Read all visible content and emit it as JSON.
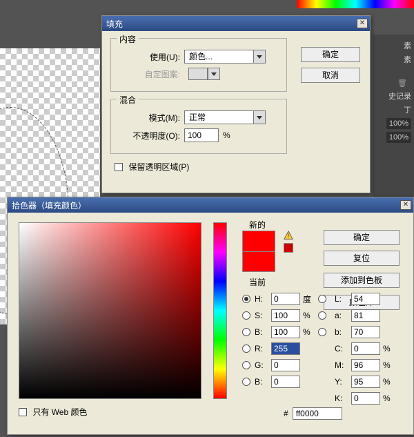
{
  "fill": {
    "title": "填充",
    "group_content": "内容",
    "use_label": "使用(U):",
    "use_value": "颜色...",
    "pattern_label": "自定图案:",
    "group_blend": "混合",
    "mode_label": "模式(M):",
    "mode_value": "正常",
    "opacity_label": "不透明度(O):",
    "opacity_value": "100",
    "opacity_unit": "%",
    "preserve_transparency": "保留透明区域(P)",
    "ok": "确定",
    "cancel": "取消"
  },
  "picker": {
    "title": "拾色器（填充颜色）",
    "new_label": "新的",
    "current_label": "当前",
    "ok": "确定",
    "reset": "复位",
    "add_swatch": "添加到色板",
    "color_lib": "颜色库",
    "H": {
      "label": "H:",
      "value": "0",
      "unit": "度"
    },
    "S": {
      "label": "S:",
      "value": "100",
      "unit": "%"
    },
    "B": {
      "label": "B:",
      "value": "100",
      "unit": "%"
    },
    "R": {
      "label": "R:",
      "value": "255"
    },
    "G": {
      "label": "G:",
      "value": "0"
    },
    "B2": {
      "label": "B:",
      "value": "0"
    },
    "L": {
      "label": "L:",
      "value": "54"
    },
    "a": {
      "label": "a:",
      "value": "81"
    },
    "b": {
      "label": "b:",
      "value": "70"
    },
    "C": {
      "label": "C:",
      "value": "0",
      "unit": "%"
    },
    "M": {
      "label": "M:",
      "value": "96",
      "unit": "%"
    },
    "Y": {
      "label": "Y:",
      "value": "95",
      "unit": "%"
    },
    "K": {
      "label": "K:",
      "value": "0",
      "unit": "%"
    },
    "hex_label": "#",
    "hex_value": "ff0000",
    "web_only": "只有 Web 颜色"
  },
  "rightpanel": {
    "tab1": "素",
    "tab2": "素",
    "tab3": "史记录",
    "t": "丁",
    "p100": "100%",
    "p100b": "100%"
  }
}
